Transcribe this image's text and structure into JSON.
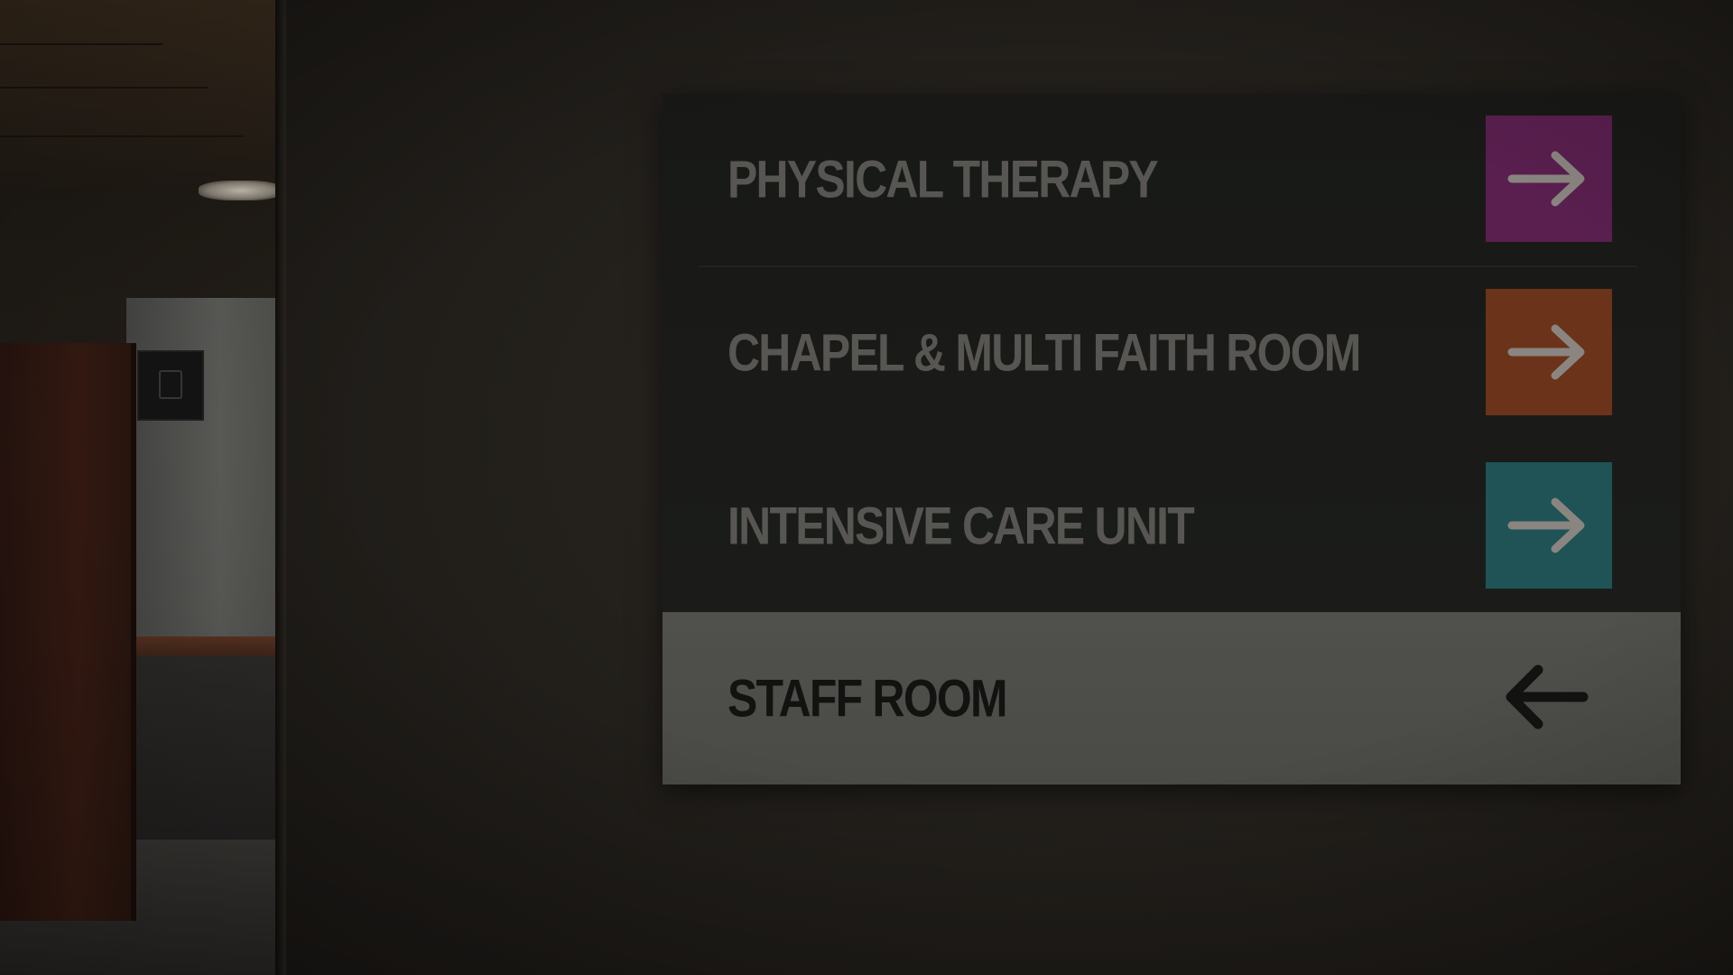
{
  "sign": {
    "rows": [
      {
        "label": "PHYSICAL THERAPY",
        "arrow_color": "#5a1f4f",
        "arrow_icon": "arrow-right-icon"
      },
      {
        "label": "CHAPEL & MULTI FAITH ROOM",
        "arrow_color": "#6b3319",
        "arrow_icon": "arrow-right-icon"
      },
      {
        "label": "INTENSIVE  CARE UNIT",
        "arrow_color": "#1f5356",
        "arrow_icon": "arrow-right-icon"
      }
    ],
    "staff_row": {
      "label": "STAFF ROOM",
      "arrow_icon": "arrow-left-icon"
    }
  },
  "colors": {
    "sign_dark": "#1a1b19",
    "sign_light": "#4d4d49",
    "dark_text": "#575653",
    "light_text": "#121211",
    "arrow_stroke": "#8a8580"
  }
}
